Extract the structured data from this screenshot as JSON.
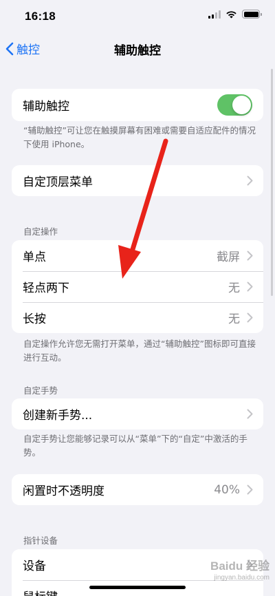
{
  "status_bar": {
    "time": "16:18"
  },
  "nav": {
    "back_label": "触控",
    "title": "辅助触控"
  },
  "assistive_touch": {
    "label": "辅助触控",
    "toggle_on": true,
    "toggle_color": "#5fc266",
    "footer": "“辅助触控”可让您在触摸屏幕有困难或需要自适应配件的情况下使用 iPhone。"
  },
  "top_menu": {
    "label": "自定顶层菜单"
  },
  "custom_actions": {
    "header": "自定操作",
    "rows": [
      {
        "label": "单点",
        "value": "截屏"
      },
      {
        "label": "轻点两下",
        "value": "无"
      },
      {
        "label": "长按",
        "value": "无"
      }
    ],
    "footer": "自定操作允许您无需打开菜单，通过“辅助触控”图标即可直接进行互动。"
  },
  "custom_gestures": {
    "header": "自定手势",
    "create_label": "创建新手势...",
    "footer": "自定手势让您能够记录可以从“菜单”下的“自定”中激活的手势。"
  },
  "idle_opacity": {
    "label": "闲置时不透明度",
    "value": "40%"
  },
  "pointer_devices": {
    "header": "指针设备",
    "rows": [
      {
        "label": "设备"
      },
      {
        "label": "鼠标键"
      }
    ]
  },
  "watermark": {
    "brand": "Baidu 经验",
    "sub": "jingyan.baidu.com"
  },
  "accent_color": "#1e74f5",
  "annotation_arrow_color": "#e8231a"
}
